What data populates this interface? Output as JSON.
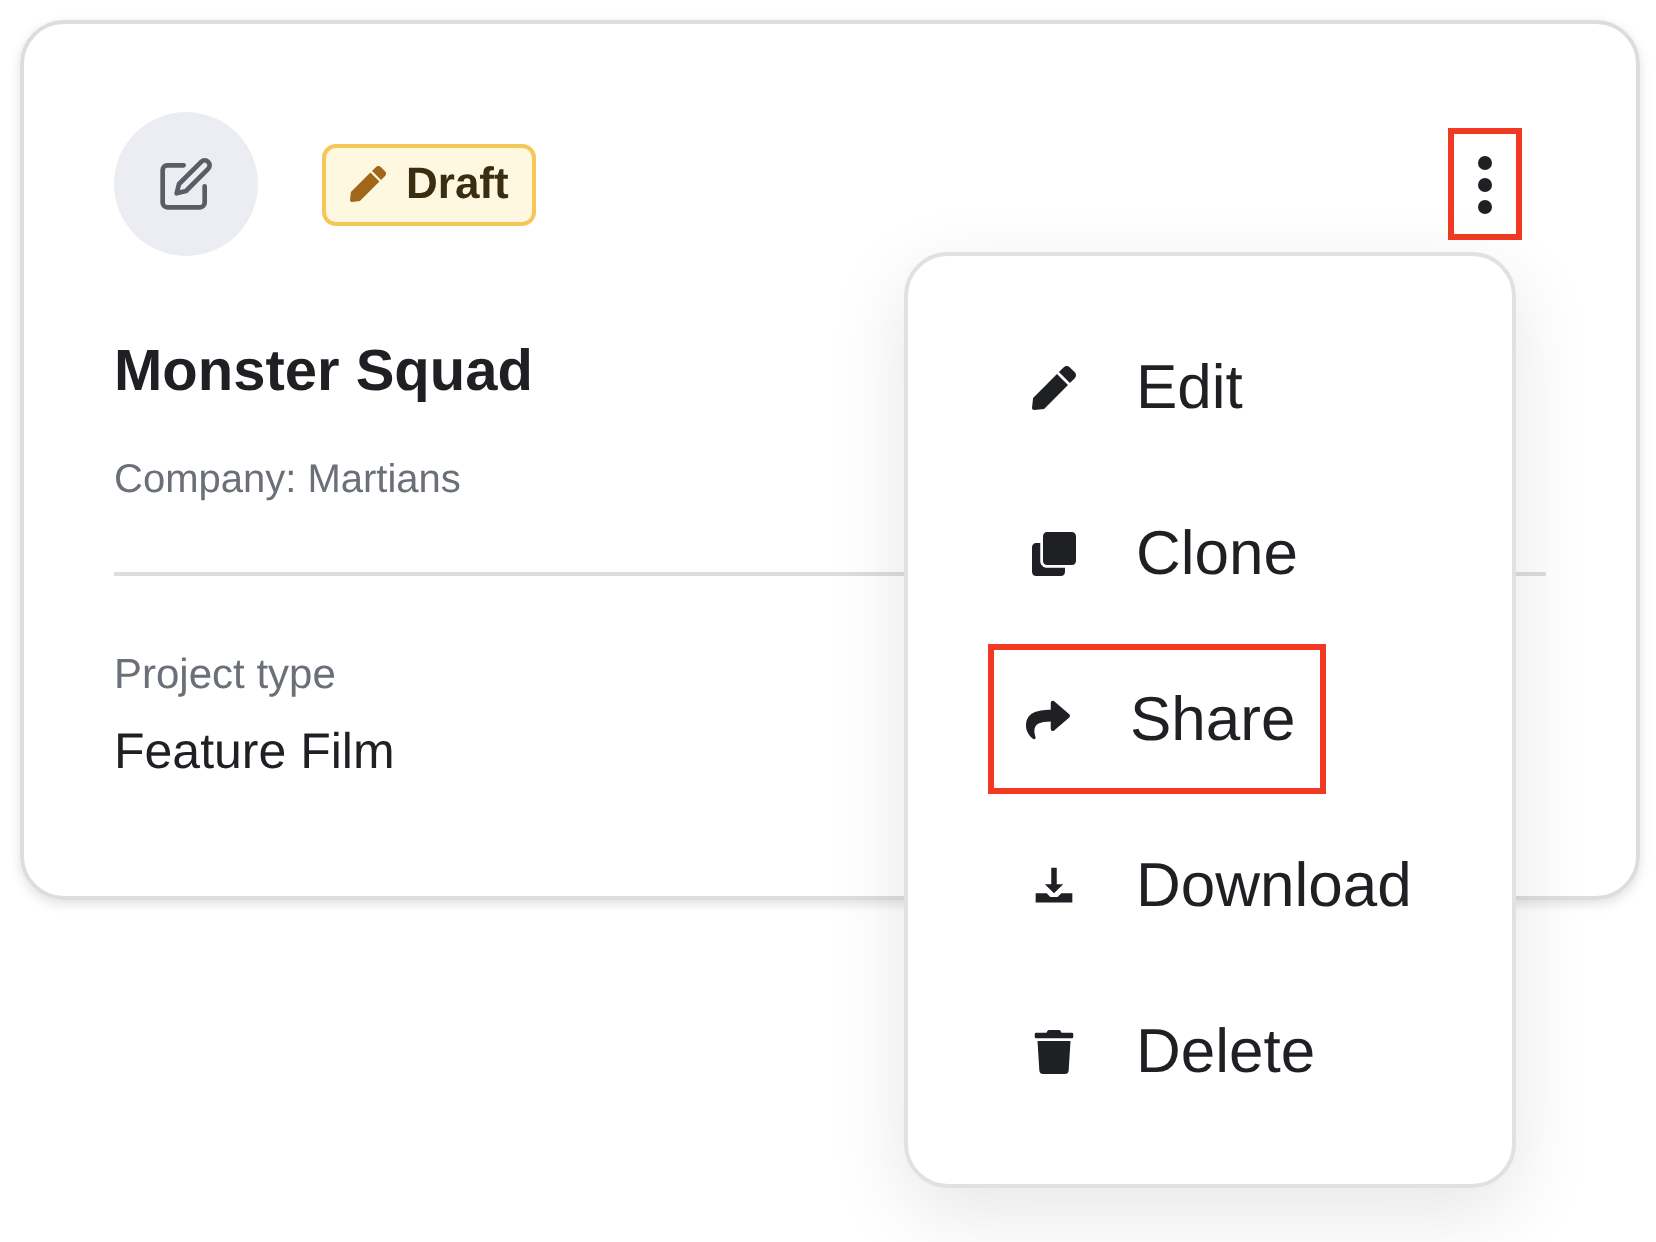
{
  "card": {
    "badge": {
      "label": "Draft"
    },
    "title": "Monster Squad",
    "company": "Company: Martians",
    "fields": [
      {
        "label": "Project type",
        "value": "Feature Film"
      }
    ],
    "more_button": {
      "highlighted": true
    }
  },
  "menu": {
    "items": [
      {
        "kind": "edit",
        "label": "Edit",
        "highlighted": false
      },
      {
        "kind": "clone",
        "label": "Clone",
        "highlighted": false
      },
      {
        "kind": "share",
        "label": "Share",
        "highlighted": true
      },
      {
        "kind": "download",
        "label": "Download",
        "highlighted": false
      },
      {
        "kind": "delete",
        "label": "Delete",
        "highlighted": false
      }
    ]
  }
}
